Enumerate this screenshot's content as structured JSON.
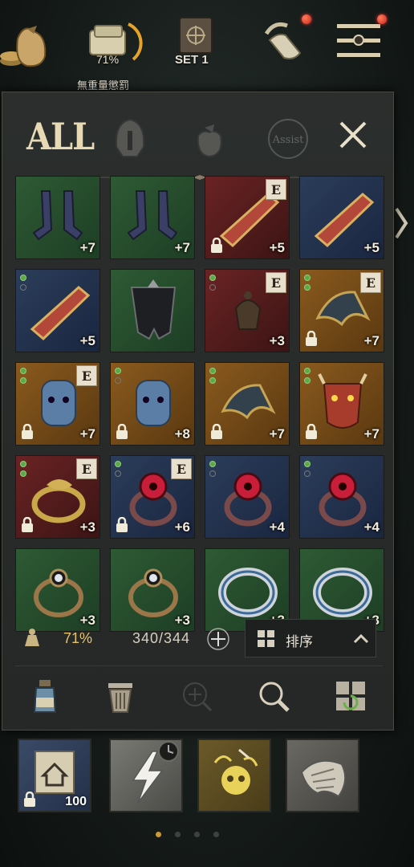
{
  "top_bar": {
    "weight_percent": "71%",
    "weight_status": "無重量懲罰",
    "set_label": "SET 1"
  },
  "tabs": {
    "all_label": "ALL",
    "assist_label": "Assist"
  },
  "inventory_items": [
    {
      "name": "greaves",
      "rarity": "green",
      "plus": "+7",
      "badge": "",
      "locked": false
    },
    {
      "name": "greaves",
      "rarity": "green",
      "plus": "+7",
      "badge": "",
      "locked": false
    },
    {
      "name": "gauntlet",
      "rarity": "red",
      "plus": "+5",
      "badge": "E",
      "locked": true
    },
    {
      "name": "gauntlet",
      "rarity": "blue",
      "plus": "+5",
      "badge": "",
      "locked": false
    },
    {
      "name": "gauntlet",
      "rarity": "blue",
      "plus": "+5",
      "badge": "",
      "locked": false
    },
    {
      "name": "cloak",
      "rarity": "green",
      "plus": "",
      "badge": "",
      "locked": false
    },
    {
      "name": "incense",
      "rarity": "red",
      "plus": "+3",
      "badge": "E",
      "locked": false
    },
    {
      "name": "shoulder-armor",
      "rarity": "orange",
      "plus": "+7",
      "badge": "E",
      "locked": true
    },
    {
      "name": "mask",
      "rarity": "orange",
      "plus": "+7",
      "badge": "E",
      "locked": true
    },
    {
      "name": "mask",
      "rarity": "orange",
      "plus": "+8",
      "badge": "",
      "locked": true
    },
    {
      "name": "shoulder-armor",
      "rarity": "orange",
      "plus": "+7",
      "badge": "",
      "locked": true
    },
    {
      "name": "demon-mask",
      "rarity": "orange",
      "plus": "+7",
      "badge": "",
      "locked": true
    },
    {
      "name": "gold-ring",
      "rarity": "red",
      "plus": "+3",
      "badge": "E",
      "locked": true
    },
    {
      "name": "eye-ring",
      "rarity": "blue",
      "plus": "+6",
      "badge": "E",
      "locked": true
    },
    {
      "name": "eye-ring",
      "rarity": "blue",
      "plus": "+4",
      "badge": "",
      "locked": false
    },
    {
      "name": "eye-ring",
      "rarity": "blue",
      "plus": "+4",
      "badge": "",
      "locked": false
    },
    {
      "name": "pearl-ring",
      "rarity": "green",
      "plus": "+3",
      "badge": "",
      "locked": false
    },
    {
      "name": "pearl-ring",
      "rarity": "green",
      "plus": "+3",
      "badge": "",
      "locked": false
    },
    {
      "name": "silver-ring",
      "rarity": "green",
      "plus": "+3",
      "badge": "",
      "locked": false
    },
    {
      "name": "silver-ring",
      "rarity": "green",
      "plus": "+3",
      "badge": "",
      "locked": false
    }
  ],
  "status": {
    "weight_percent": "71%",
    "capacity": "340/344",
    "sort_label": "排序"
  },
  "quick_slots": {
    "home_count": "100"
  },
  "colors": {
    "accent_gold": "#e6c36a",
    "rarity_green": "#2e5a34",
    "rarity_blue": "#2b3d5a",
    "rarity_red": "#6a2324",
    "rarity_orange": "#8a5a1e"
  }
}
